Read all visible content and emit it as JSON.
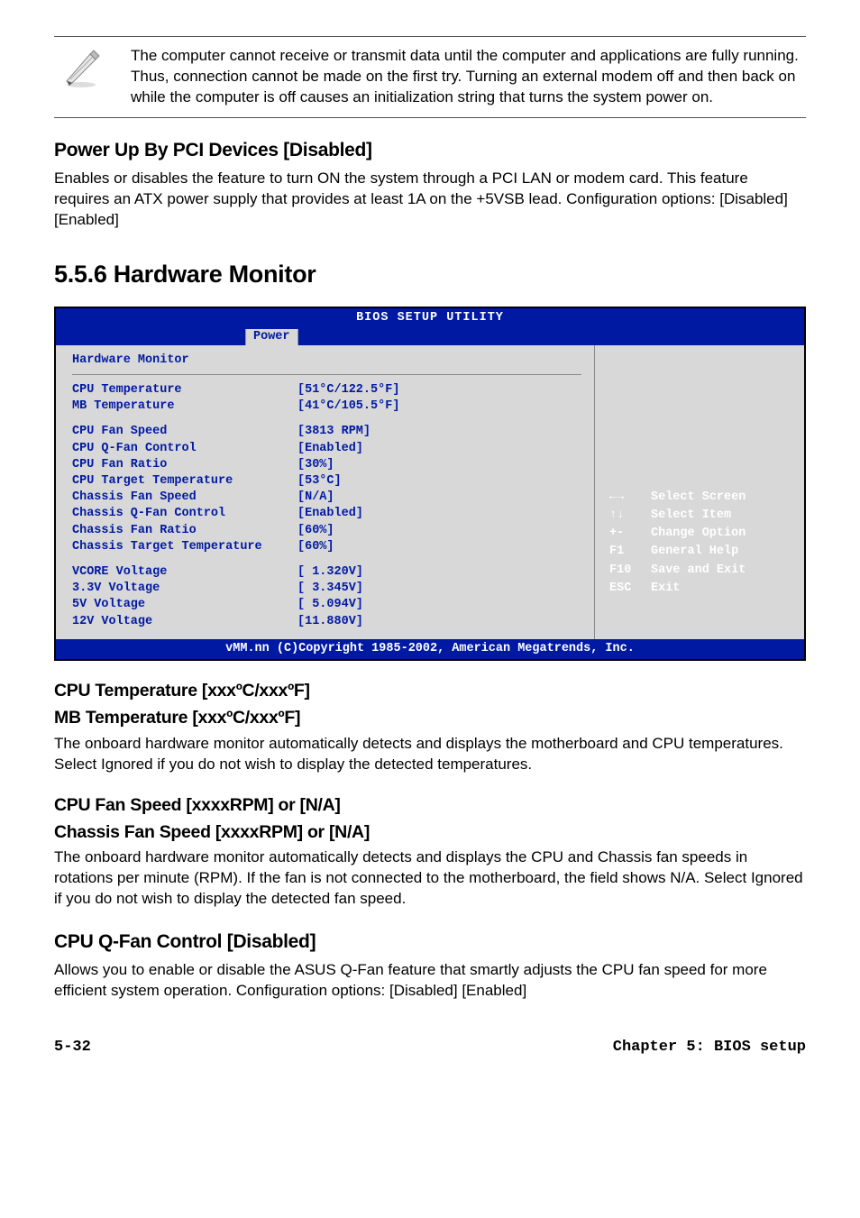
{
  "note": {
    "text": "The computer cannot receive or transmit data until the computer and applications are fully running. Thus, connection cannot be made on the first try. Turning an external modem off and then back on while the computer is off causes an initialization string that turns the system power on."
  },
  "sec_powerup": {
    "heading": "Power Up By PCI Devices [Disabled]",
    "body": "Enables or disables the feature to turn ON the system through a PCI LAN or modem card. This feature requires an ATX power supply that provides at least 1A on the +5VSB lead. Configuration options: [Disabled] [Enabled]"
  },
  "section_number_heading": "5.5.6   Hardware Monitor",
  "bios": {
    "title": "BIOS SETUP UTILITY",
    "tab": "Power",
    "panel_heading": "Hardware Monitor",
    "rows_a": [
      {
        "label": "CPU Temperature",
        "value": "[51°C/122.5°F]"
      },
      {
        "label": "MB Temperature",
        "value": "[41°C/105.5°F]"
      }
    ],
    "rows_b": [
      {
        "label": "CPU Fan Speed",
        "value": "[3813 RPM]"
      },
      {
        "label": "CPU Q-Fan Control",
        "value": "[Enabled]"
      },
      {
        "label": "CPU Fan Ratio",
        "value": "[30%]"
      },
      {
        "label": "CPU Target Temperature",
        "value": "[53°C]"
      },
      {
        "label": "Chassis Fan Speed",
        "value": "[N/A]"
      },
      {
        "label": "Chassis Q-Fan Control",
        "value": "[Enabled]"
      },
      {
        "label": "Chassis Fan Ratio",
        "value": "[60%]"
      },
      {
        "label": "Chassis Target Temperature",
        "value": "[60%]"
      }
    ],
    "rows_c": [
      {
        "label": "VCORE Voltage",
        "value": "[ 1.320V]"
      },
      {
        "label": "3.3V Voltage",
        "value": "[ 3.345V]"
      },
      {
        "label": "5V Voltage",
        "value": "[ 5.094V]"
      },
      {
        "label": "12V Voltage",
        "value": "[11.880V]"
      }
    ],
    "hints": [
      {
        "key": "←→",
        "text": "Select Screen"
      },
      {
        "key": "↑↓",
        "text": "Select Item"
      },
      {
        "key": "+-",
        "text": "Change Option"
      },
      {
        "key": "F1",
        "text": "General Help"
      },
      {
        "key": "F10",
        "text": "Save and Exit"
      },
      {
        "key": "ESC",
        "text": "Exit"
      }
    ],
    "footer": "vMM.nn (C)Copyright 1985-2002, American Megatrends, Inc."
  },
  "sec_temp": {
    "h1": "CPU Temperature [xxxºC/xxxºF]",
    "h2": "MB Temperature [xxxºC/xxxºF]",
    "body": "The onboard hardware monitor automatically detects and displays the motherboard and CPU temperatures. Select Ignored if you do not wish to display the detected temperatures."
  },
  "sec_fan": {
    "h1": "CPU Fan Speed [xxxxRPM] or [N/A]",
    "h2": "Chassis Fan Speed [xxxxRPM] or [N/A]",
    "body": "The onboard hardware monitor automatically detects and displays the CPU and Chassis fan speeds in rotations per minute (RPM). If the fan is not connected to the motherboard, the field shows N/A. Select Ignored if you do not wish to display the detected fan speed."
  },
  "sec_qfan": {
    "h1": "CPU Q-Fan Control [Disabled]",
    "body": "Allows you to enable or disable the ASUS Q-Fan feature that smartly adjusts the CPU fan speed for more efficient system operation. Configuration options: [Disabled] [Enabled]"
  },
  "footer": {
    "left": "5-32",
    "right": "Chapter 5: BIOS setup"
  }
}
